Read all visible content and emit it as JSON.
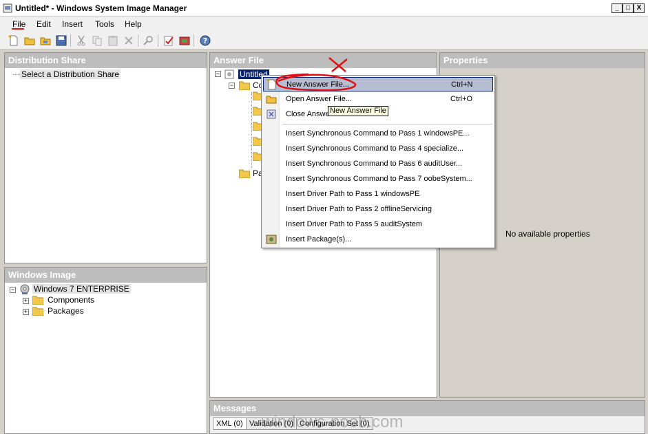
{
  "window": {
    "title": "Untitled* - Windows System Image Manager",
    "minimize_glyph": "_",
    "maximize_glyph": "□",
    "close_glyph": "X"
  },
  "menubar": {
    "items": [
      "File",
      "Edit",
      "Insert",
      "Tools",
      "Help"
    ]
  },
  "toolbar": {
    "icons": [
      "new-icon",
      "open-icon",
      "open-folder-icon",
      "save-icon",
      "cut-icon",
      "copy-icon",
      "paste-icon",
      "delete-icon",
      "find-icon",
      "validate-icon",
      "create-config-set-icon",
      "help-icon"
    ]
  },
  "distribution_share": {
    "header": "Distribution Share",
    "item": "Select a Distribution Share"
  },
  "windows_image": {
    "header": "Windows Image",
    "root": "Windows 7 ENTERPRISE",
    "children": [
      "Components",
      "Packages"
    ]
  },
  "answer_file": {
    "header": "Answer File",
    "root": "Untitled",
    "child_components": "Co",
    "child_packages": "Pa"
  },
  "properties": {
    "header": "Properties",
    "empty_text": "No available properties"
  },
  "context_menu": {
    "items": [
      {
        "label": "New Answer File...",
        "shortcut": "Ctrl+N"
      },
      {
        "label": "Open Answer File...",
        "shortcut": "Ctrl+O"
      },
      {
        "label": "Close Answer File",
        "shortcut": ""
      },
      {
        "label": "Insert Synchronous Command to Pass 1 windowsPE...",
        "shortcut": ""
      },
      {
        "label": "Insert Synchronous Command to Pass 4 specialize...",
        "shortcut": ""
      },
      {
        "label": "Insert Synchronous Command to Pass 6 auditUser...",
        "shortcut": ""
      },
      {
        "label": "Insert Synchronous Command to Pass 7 oobeSystem...",
        "shortcut": ""
      },
      {
        "label": "Insert Driver Path to Pass 1 windowsPE",
        "shortcut": ""
      },
      {
        "label": "Insert Driver Path to Pass 2 offlineServicing",
        "shortcut": ""
      },
      {
        "label": "Insert Driver Path to Pass 5 auditSystem",
        "shortcut": ""
      },
      {
        "label": "Insert Package(s)...",
        "shortcut": ""
      }
    ]
  },
  "tooltip": "New Answer File",
  "messages": {
    "header": "Messages",
    "tabs": [
      "XML (0)",
      "Validation (0)",
      "Configuration Set (0)"
    ]
  },
  "watermark": "windows-noob.com",
  "colors": {
    "pane_header": "#bdbdbd",
    "selection": "#0a246a",
    "hot_item": "#b6bdd2",
    "annotation_red": "#dd1111"
  }
}
